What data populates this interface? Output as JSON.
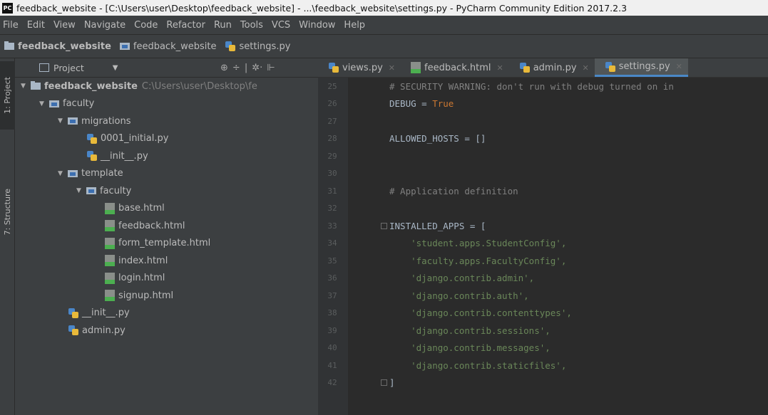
{
  "window": {
    "title": "feedback_website - [C:\\Users\\user\\Desktop\\feedback_website] - ...\\feedback_website\\settings.py - PyCharm Community Edition 2017.2.3",
    "logo_text": "PC"
  },
  "menu": [
    "File",
    "Edit",
    "View",
    "Navigate",
    "Code",
    "Refactor",
    "Run",
    "Tools",
    "VCS",
    "Window",
    "Help"
  ],
  "breadcrumb": {
    "project": "feedback_website",
    "module": "feedback_website",
    "file": "settings.py"
  },
  "side_tabs": {
    "project": "1: Project",
    "structure": "7: Structure"
  },
  "project_panel": {
    "title": "Project",
    "tools": [
      "⊕",
      "÷",
      "|",
      "✲·",
      "⊩"
    ],
    "tree": [
      {
        "label": "feedback_website",
        "path": "C:\\Users\\user\\Desktop\\fe",
        "type": "folder",
        "depth": 0,
        "expanded": true,
        "bold": true
      },
      {
        "label": "faculty",
        "type": "module",
        "depth": 1,
        "expanded": true
      },
      {
        "label": "migrations",
        "type": "module",
        "depth": 2,
        "expanded": true
      },
      {
        "label": "0001_initial.py",
        "type": "py",
        "depth": 3
      },
      {
        "label": "__init__.py",
        "type": "py",
        "depth": 3
      },
      {
        "label": "template",
        "type": "module",
        "depth": 2,
        "expanded": true
      },
      {
        "label": "faculty",
        "type": "module",
        "depth": 3,
        "expanded": true
      },
      {
        "label": "base.html",
        "type": "html",
        "depth": 4
      },
      {
        "label": "feedback.html",
        "type": "html",
        "depth": 4
      },
      {
        "label": "form_template.html",
        "type": "html",
        "depth": 4
      },
      {
        "label": "index.html",
        "type": "html",
        "depth": 4
      },
      {
        "label": "login.html",
        "type": "html",
        "depth": 4
      },
      {
        "label": "signup.html",
        "type": "html",
        "depth": 4
      },
      {
        "label": "__init__.py",
        "type": "py",
        "depth": 2
      },
      {
        "label": "admin.py",
        "type": "py",
        "depth": 2
      }
    ]
  },
  "editor_tabs": [
    {
      "label": "views.py",
      "type": "py",
      "active": false
    },
    {
      "label": "feedback.html",
      "type": "html",
      "active": false
    },
    {
      "label": "admin.py",
      "type": "py",
      "active": false
    },
    {
      "label": "settings.py",
      "type": "py",
      "active": true
    }
  ],
  "code_lines": [
    {
      "num": "25",
      "text": "# SECURITY WARNING: don't run with debug turned on in",
      "style": "comment"
    },
    {
      "num": "26",
      "text": "DEBUG = ",
      "tail": "True",
      "style": "assign-kw"
    },
    {
      "num": "27",
      "text": "",
      "style": "plain"
    },
    {
      "num": "28",
      "text": "ALLOWED_HOSTS = []",
      "style": "plain"
    },
    {
      "num": "29",
      "text": "",
      "style": "plain"
    },
    {
      "num": "30",
      "text": "",
      "style": "plain"
    },
    {
      "num": "31",
      "text": "# Application definition",
      "style": "comment"
    },
    {
      "num": "32",
      "text": "",
      "style": "plain"
    },
    {
      "num": "33",
      "text": "INSTALLED_APPS = [",
      "style": "plain",
      "fold": true
    },
    {
      "num": "34",
      "text": "    'student.apps.StudentConfig',",
      "style": "string"
    },
    {
      "num": "35",
      "text": "    'faculty.apps.FacultyConfig',",
      "style": "string"
    },
    {
      "num": "36",
      "text": "    'django.contrib.admin',",
      "style": "string"
    },
    {
      "num": "37",
      "text": "    'django.contrib.auth',",
      "style": "string"
    },
    {
      "num": "38",
      "text": "    'django.contrib.contenttypes',",
      "style": "string"
    },
    {
      "num": "39",
      "text": "    'django.contrib.sessions',",
      "style": "string"
    },
    {
      "num": "40",
      "text": "    'django.contrib.messages',",
      "style": "string"
    },
    {
      "num": "41",
      "text": "    'django.contrib.staticfiles',",
      "style": "string"
    },
    {
      "num": "42",
      "text": "]",
      "style": "plain",
      "fold": true
    }
  ],
  "colors": {
    "background": "#3c3f41",
    "editor_bg": "#2b2b2b",
    "comment": "#808080",
    "string": "#6a8759",
    "keyword": "#cc7832",
    "active_tab_underline": "#4a88c7"
  }
}
